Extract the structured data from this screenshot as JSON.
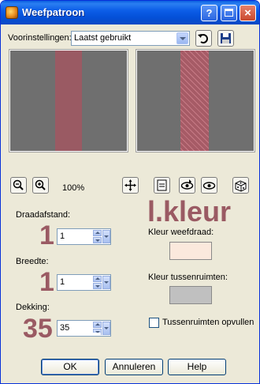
{
  "window": {
    "title": "Weefpatroon",
    "accent": "#0a49c4",
    "title_buttons": {
      "help": "?",
      "close": "×"
    }
  },
  "presets": {
    "label": "Voorinstellingen:",
    "selected": "Laatst gebruikt",
    "reset_icon": "reset-arrow-icon",
    "save_icon": "floppy-disk-icon"
  },
  "preview": {
    "zoom_percent": "100%",
    "strand_color": "#9a5a63",
    "background_color": "#6f6f6f",
    "toolbar_icons": [
      "zoom-out-icon",
      "zoom-in-icon",
      "pan-icon",
      "preview-toggle-icon",
      "proof-icon",
      "auto-proof-icon",
      "randomize-icon"
    ]
  },
  "settings": {
    "draadafstand": {
      "label": "Draadafstand:",
      "value": "1",
      "annotation": "1"
    },
    "breedte": {
      "label": "Breedte:",
      "value": "1",
      "annotation": "1"
    },
    "dekking": {
      "label": "Dekking:",
      "value": "35",
      "annotation": "35",
      "level_percent": 35
    }
  },
  "colors": {
    "overlay_text": "l.kleur",
    "weefdraad_label": "Kleur weefdraad:",
    "weefdraad_color": "#fbe9dd",
    "tussenruimten_label": "Kleur tussenruimten:",
    "tussenruimten_color": "#c0c0c0",
    "fill_gaps_label": "Tussenruimten opvullen",
    "fill_gaps_checked": false
  },
  "buttons": {
    "ok": "OK",
    "cancel": "Annuleren",
    "help": "Help"
  }
}
